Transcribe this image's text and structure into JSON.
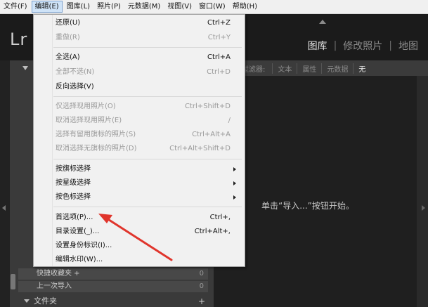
{
  "menubar": {
    "items": [
      "文件(F)",
      "编辑(E)",
      "图库(L)",
      "照片(P)",
      "元数据(M)",
      "视图(V)",
      "窗口(W)",
      "帮助(H)"
    ]
  },
  "app": {
    "logo": "Lr",
    "modules": [
      "图库",
      "修改照片",
      "地图"
    ],
    "module_sep": "|"
  },
  "filter": {
    "label": "过滤器:",
    "options": [
      "文本",
      "属性",
      "元数据",
      "无"
    ]
  },
  "main": {
    "message": "单击“导入...”按钮开始。"
  },
  "left_panel": {
    "rows": [
      {
        "label": "快捷收藏夹 +",
        "count": "0"
      },
      {
        "label": "上一次导入",
        "count": "0"
      }
    ],
    "folder_header": "文件夹",
    "folder_add": "+"
  },
  "edit_menu": {
    "items": [
      {
        "label": "还原(U)",
        "shortcut": "Ctrl+Z",
        "disabled": false
      },
      {
        "label": "重做(R)",
        "shortcut": "Ctrl+Y",
        "disabled": true
      },
      {
        "label": "全选(A)",
        "shortcut": "Ctrl+A",
        "disabled": false
      },
      {
        "label": "全部不选(N)",
        "shortcut": "Ctrl+D",
        "disabled": true
      },
      {
        "label": "反向选择(V)",
        "shortcut": "",
        "disabled": false
      },
      {
        "label": "仅选择现用照片(O)",
        "shortcut": "Ctrl+Shift+D",
        "disabled": true
      },
      {
        "label": "取消选择现用照片(E)",
        "shortcut": "/",
        "disabled": true
      },
      {
        "label": "选择有留用旗标的照片(S)",
        "shortcut": "Ctrl+Alt+A",
        "disabled": true
      },
      {
        "label": "取消选择无旗标的照片(D)",
        "shortcut": "Ctrl+Alt+Shift+D",
        "disabled": true
      },
      {
        "label": "按旗标选择",
        "shortcut": "",
        "disabled": false,
        "submenu": true
      },
      {
        "label": "按星级选择",
        "shortcut": "",
        "disabled": false,
        "submenu": true
      },
      {
        "label": "按色标选择",
        "shortcut": "",
        "disabled": false,
        "submenu": true
      },
      {
        "label": "首选项(P)...",
        "shortcut": "Ctrl+,",
        "disabled": false
      },
      {
        "label": "目录设置(_)...",
        "shortcut": "Ctrl+Alt+,",
        "disabled": false
      },
      {
        "label": "设置身份标识(I)...",
        "shortcut": "",
        "disabled": false
      },
      {
        "label": "编辑水印(W)...",
        "shortcut": "",
        "disabled": false
      }
    ]
  },
  "colors": {
    "annotation": "#e0352c",
    "menu_bg": "#f1f1f1",
    "app_bg": "#1f1f1f"
  }
}
